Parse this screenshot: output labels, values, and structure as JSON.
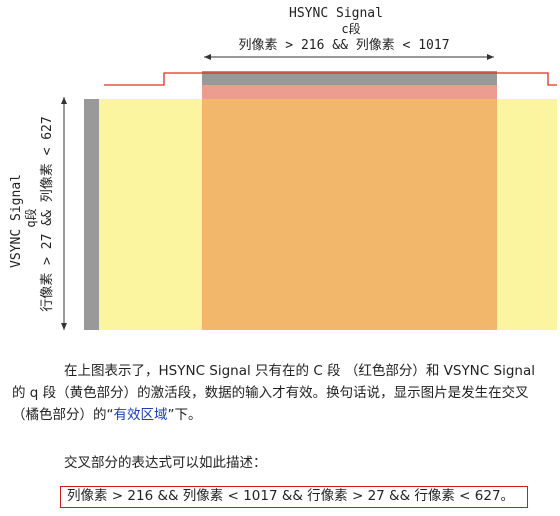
{
  "hsync": {
    "title": "HSYNC Signal",
    "segment": "c段",
    "condition": "列像素 > 216 && 列像素 < 1017"
  },
  "vsync": {
    "title": "VSYNC Signal",
    "segment": "q段",
    "condition": "行像素 > 27 && 列像素 < 627"
  },
  "colors": {
    "yellow": "#fcf5a0",
    "orange": "#f2b76a",
    "red_strip": "#ec9d8f",
    "gray": "#999999",
    "red_line": "#e0301c"
  },
  "paragraph1": {
    "before": "在上图表示了，HSYNC Signal 只有在的 C 段 （红色部分）和 VSYNC Signal 的 q 段（黄色部分）的激活段，数据的输入才有效。换句话说，显示图片是发生在交叉（橘色部分）的“",
    "highlight": "有效区域",
    "after": "”下。"
  },
  "paragraph2": "交叉部分的表达式可以如此描述：",
  "formula": "列像素 > 216 && 列像素 < 1017 && 行像素 > 27 && 行像素 < 627。"
}
